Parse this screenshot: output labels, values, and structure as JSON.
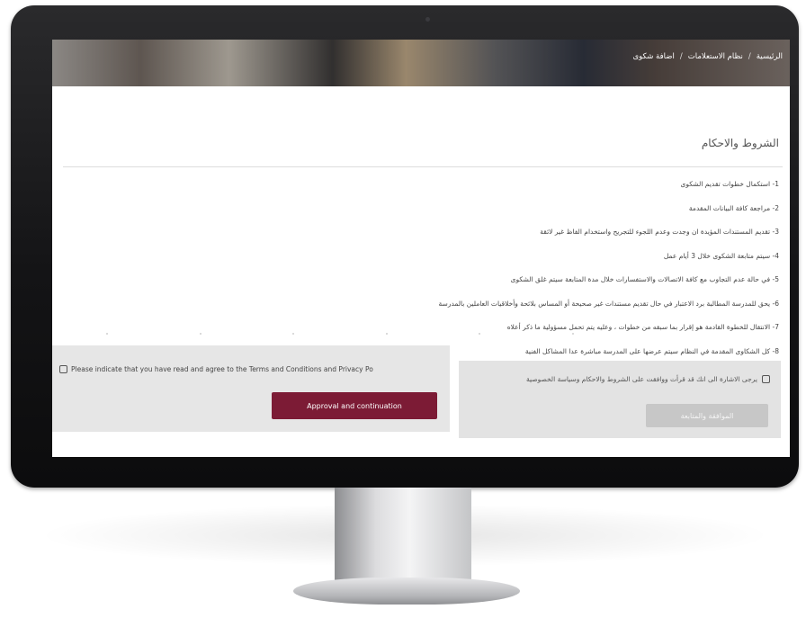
{
  "breadcrumb": {
    "home": "الرئيسية",
    "services": "نظام الاستعلامات",
    "current": "اضافة شكوى",
    "separator": "/"
  },
  "page": {
    "title": "الشروط والاحكام"
  },
  "terms": [
    "1- استكمال خطوات تقديم الشكوى",
    "2- مراجعة كافة البيانات المقدمة",
    "3- تقديم المستندات المؤيدة ان وجدت وعدم اللجوء للتجريح واستخدام الفاظ غير لائقة",
    "4- سيتم متابعة الشكوى خلال 3 أيام عمل",
    "5- في حالة عدم التجاوب مع كافة الاتصالات والاستفسارات خلال مدة المتابعة سيتم غلق الشكوى",
    "6- يحق للمدرسة المطالبة برد الاعتبار في حال تقديم مستندات غير صحيحة أو المساس بلائحة وأخلاقيات العاملين بالمدرسة",
    "7- الانتقال للخطوة القادمة هو إقرار بما سبقه من خطوات ، وعليه يتم تحمل مسؤولية ما ذكر أعلاه",
    "8- كل الشكاوى المقدمة في النظام سيتم عرضها على المدرسة مباشرة عدا المشاكل الفنية"
  ],
  "consent_en": {
    "text": "Please indicate that you have read and agree to the Terms and Conditions and Privacy Po",
    "button": "Approval and continuation"
  },
  "consent_ar": {
    "text": "يرجى الاشارة الى انك قد قرأت ووافقت على الشروط والاحكام وسياسة الخصوصية",
    "button": "الموافقة والمتابعة"
  }
}
